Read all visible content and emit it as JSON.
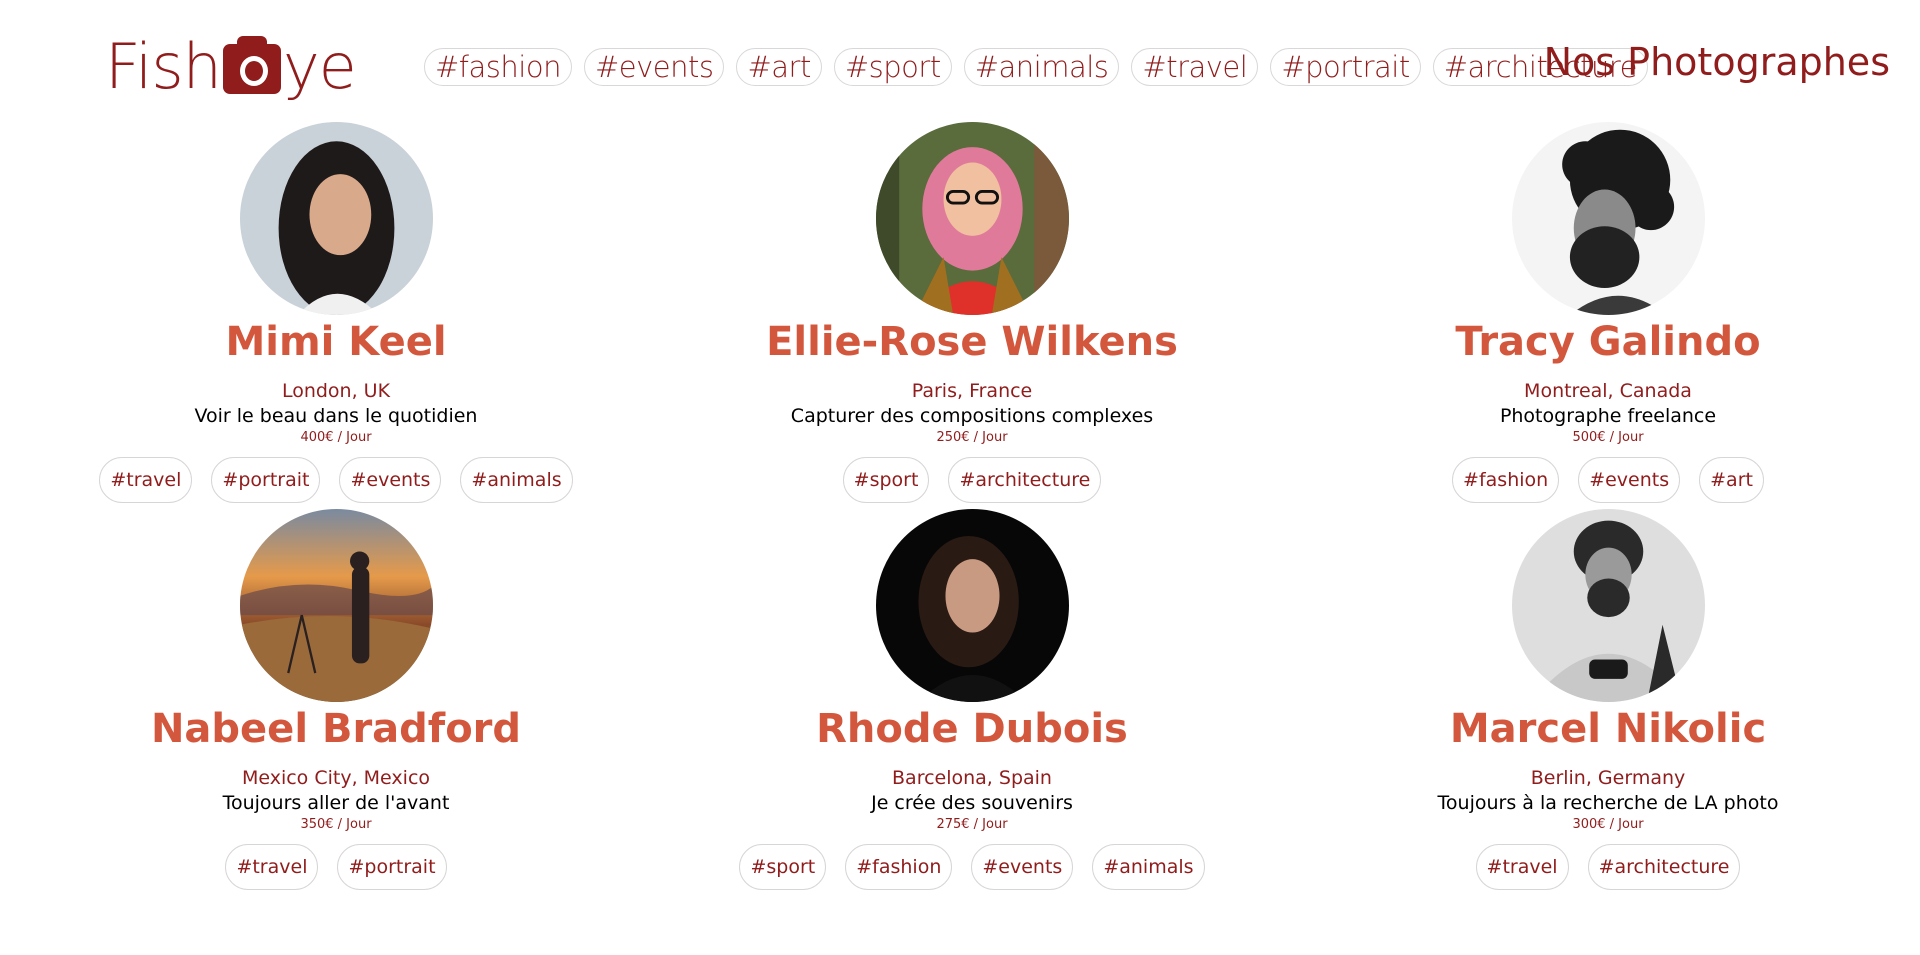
{
  "header": {
    "logo_left": "Fish",
    "logo_right": "ye",
    "logo_icon": "camera-icon",
    "title": "Nos Photographes",
    "tags": [
      "#fashion",
      "#events",
      "#art",
      "#sport",
      "#animals",
      "#travel",
      "#portrait",
      "#architecture"
    ]
  },
  "photographers": [
    {
      "name": "Mimi Keel",
      "location": "London, UK",
      "tagline": "Voir le beau dans le quotidien",
      "price": "400€ / Jour",
      "tags": [
        "#travel",
        "#portrait",
        "#events",
        "#animals"
      ],
      "portrait_colors": [
        "#c9d2d8",
        "#1f1a1a",
        "#d9a98c"
      ]
    },
    {
      "name": "Ellie-Rose Wilkens",
      "location": "Paris, France",
      "tagline": "Capturer des compositions complexes",
      "price": "250€ / Jour",
      "tags": [
        "#sport",
        "#architecture"
      ],
      "portrait_colors": [
        "#5a6b3c",
        "#e07a9a",
        "#e0302a"
      ]
    },
    {
      "name": "Tracy Galindo",
      "location": "Montreal, Canada",
      "tagline": "Photographe freelance",
      "price": "500€ / Jour",
      "tags": [
        "#fashion",
        "#events",
        "#art"
      ],
      "portrait_colors": [
        "#f4f4f4",
        "#1a1a1a",
        "#8a8a8a"
      ]
    },
    {
      "name": "Nabeel Bradford",
      "location": "Mexico City, Mexico",
      "tagline": "Toujours aller de l'avant",
      "price": "350€ / Jour",
      "tags": [
        "#travel",
        "#portrait"
      ],
      "portrait_colors": [
        "#e59a4a",
        "#5a3a2a",
        "#2a2020"
      ]
    },
    {
      "name": "Rhode Dubois",
      "location": "Barcelona, Spain",
      "tagline": "Je crée des souvenirs",
      "price": "275€ / Jour",
      "tags": [
        "#sport",
        "#fashion",
        "#events",
        "#animals"
      ],
      "portrait_colors": [
        "#070707",
        "#2a1a14",
        "#c89a82"
      ]
    },
    {
      "name": "Marcel Nikolic",
      "location": "Berlin, Germany",
      "tagline": "Toujours à la recherche de LA photo",
      "price": "300€ / Jour",
      "tags": [
        "#travel",
        "#architecture"
      ],
      "portrait_colors": [
        "#dedede",
        "#2a2a2a",
        "#9a9a9a"
      ]
    }
  ]
}
